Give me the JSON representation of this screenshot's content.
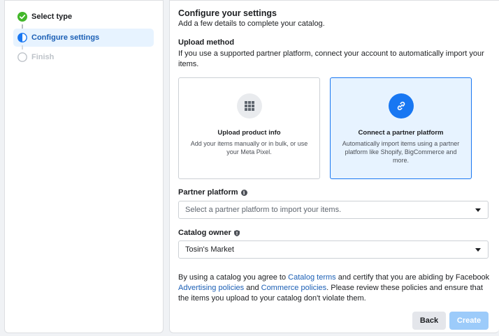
{
  "steps": [
    {
      "label": "Select type",
      "state": "complete"
    },
    {
      "label": "Configure settings",
      "state": "active"
    },
    {
      "label": "Finish",
      "state": "pending"
    }
  ],
  "header": {
    "title": "Configure your settings",
    "subtitle": "Add a few details to complete your catalog."
  },
  "upload_method": {
    "title": "Upload method",
    "description": "If you use a supported partner platform, connect your account to automatically import your items.",
    "options": [
      {
        "title": "Upload product info",
        "description": "Add your items manually or in bulk, or use your Meta Pixel.",
        "icon": "grid-icon",
        "selected": false
      },
      {
        "title": "Connect a partner platform",
        "description": "Automatically import items using a partner platform like Shopify, BigCommerce and more.",
        "icon": "link-icon",
        "selected": true
      }
    ]
  },
  "partner_platform": {
    "label": "Partner platform",
    "placeholder": "Select a partner platform to import your items."
  },
  "catalog_owner": {
    "label": "Catalog owner",
    "value": "Tosin's Market"
  },
  "terms": {
    "t1": "By using a catalog you agree to ",
    "link1": "Catalog terms",
    "t2": " and certify that you are abiding by Facebook ",
    "link2": "Advertising policies",
    "t3": " and ",
    "link3": "Commerce policies",
    "t4": ". Please review these policies and ensure that the items you upload to your catalog don't violate them."
  },
  "buttons": {
    "back": "Back",
    "create": "Create"
  },
  "colors": {
    "accent": "#1877f2",
    "success": "#42b72a",
    "active_bg": "#e7f3ff"
  }
}
